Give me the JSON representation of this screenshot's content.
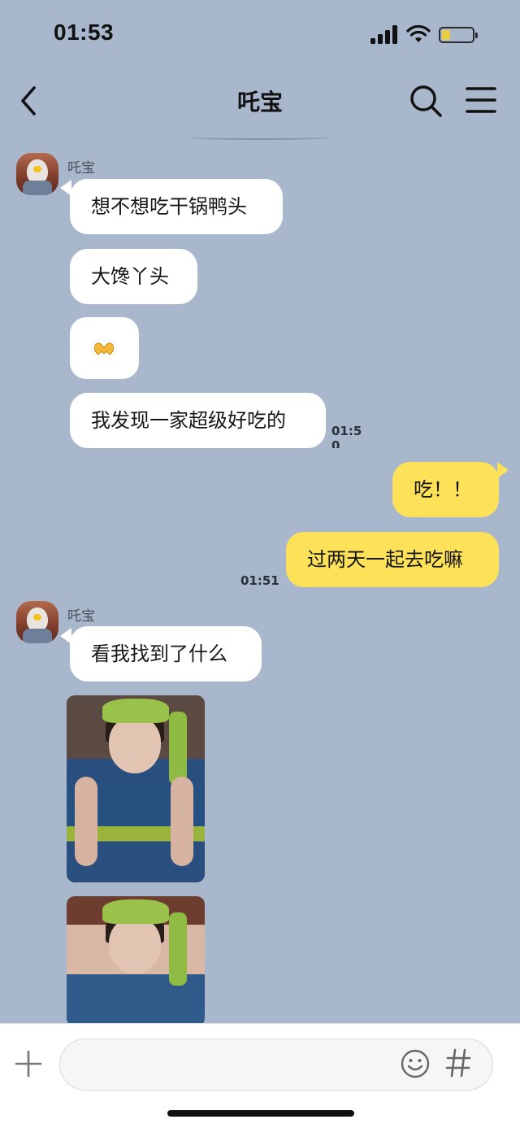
{
  "status_bar": {
    "time": "01:53"
  },
  "header": {
    "title": "吒宝"
  },
  "messages": [
    {
      "sender": "吒宝"
    },
    {
      "text": "想不想吃干锅鸭头"
    },
    {
      "text": "大馋丫头"
    },
    {
      "text": "我发现一家超级好吃的",
      "time": "01:50"
    },
    {
      "text": "吃！！"
    },
    {
      "text": "过两天一起去吃嘛",
      "time": "01:51"
    },
    {
      "sender": "吒宝"
    },
    {
      "text": "看我找到了什么"
    }
  ],
  "input": {
    "value": "",
    "placeholder": ""
  },
  "colors": {
    "background": "#a8b7cb",
    "incoming_bubble": "#ffffff",
    "outgoing_bubble": "#fde259"
  }
}
